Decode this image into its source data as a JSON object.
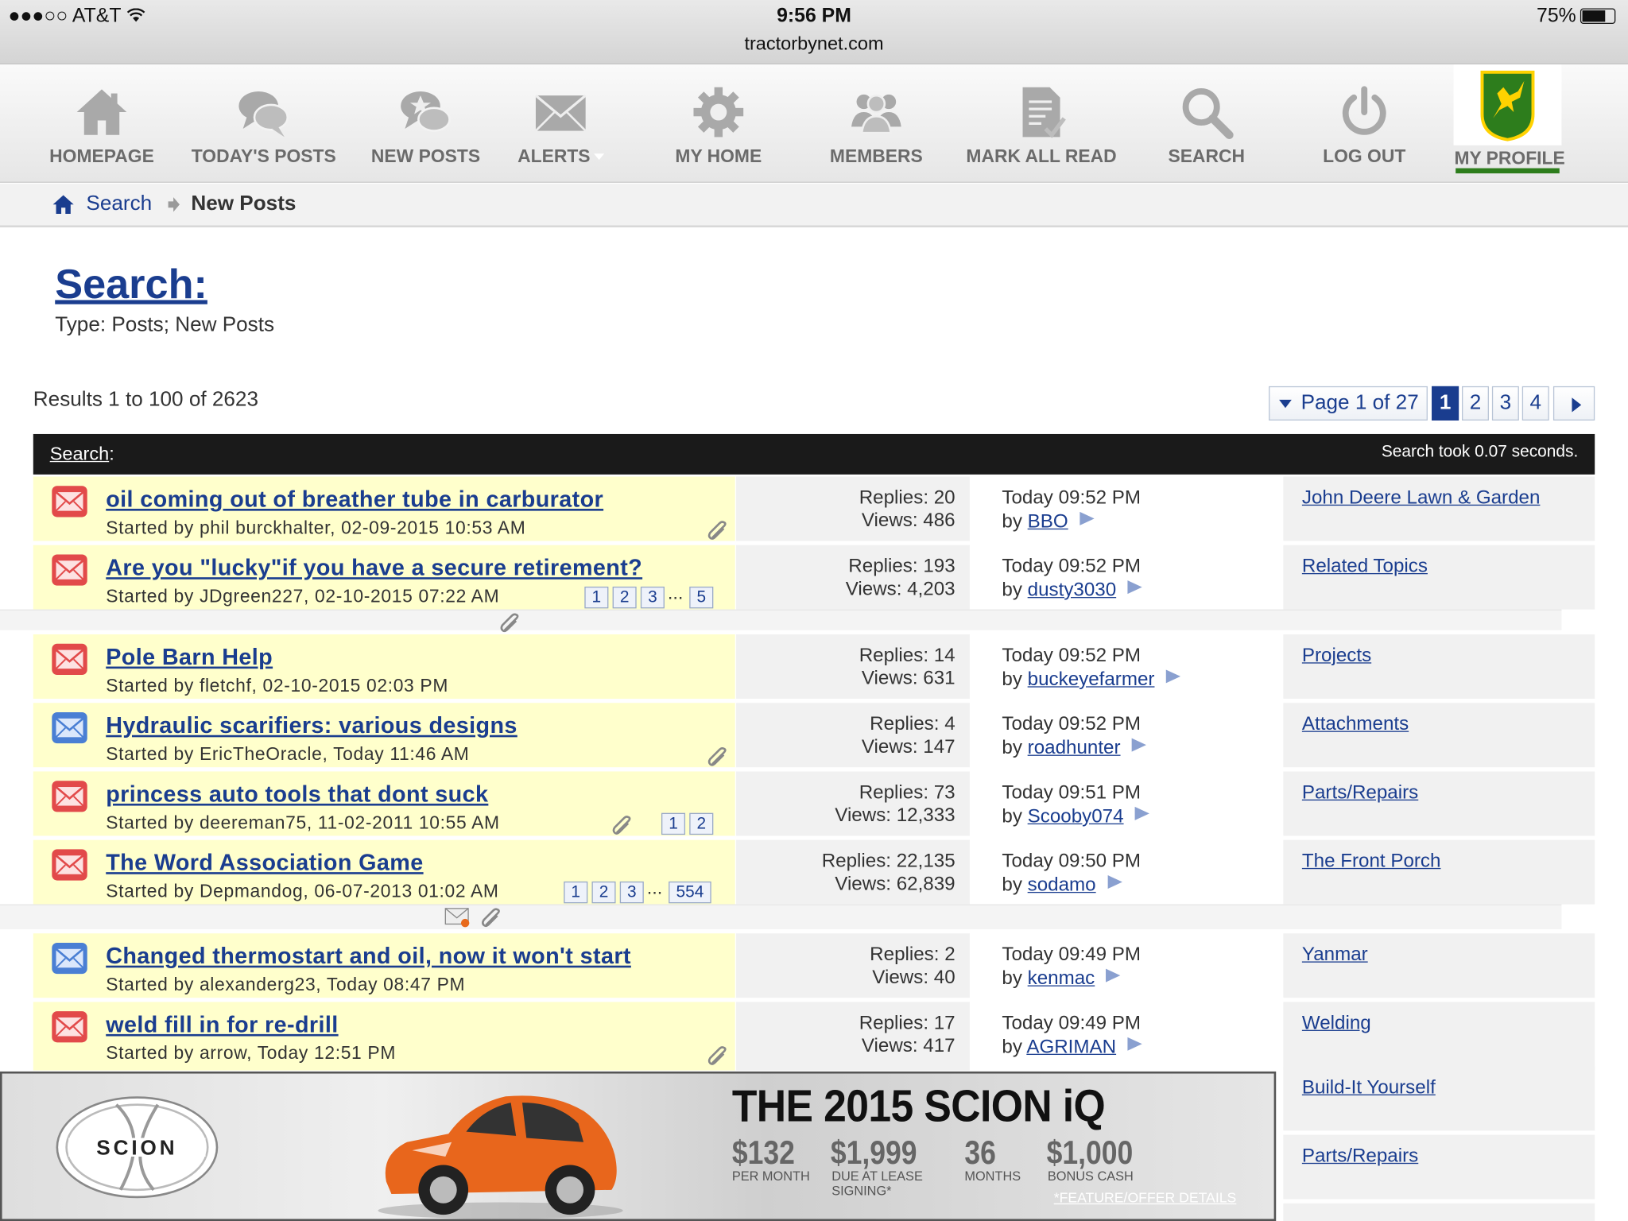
{
  "status_bar": {
    "carrier": "●●●○○ AT&T",
    "time": "9:56 PM",
    "url": "tractorbynet.com",
    "battery": "75%"
  },
  "nav": {
    "items": [
      {
        "label": "HOMEPAGE",
        "icon": "home-icon"
      },
      {
        "label": "TODAY'S POSTS",
        "icon": "chat-bubbles-icon"
      },
      {
        "label": "NEW POSTS",
        "icon": "chat-star-icon"
      },
      {
        "label": "ALERTS",
        "icon": "envelope-icon"
      },
      {
        "label": "MY HOME",
        "icon": "gear-icon"
      },
      {
        "label": "MEMBERS",
        "icon": "members-icon"
      },
      {
        "label": "MARK ALL READ",
        "icon": "document-check-icon"
      },
      {
        "label": "SEARCH",
        "icon": "magnifier-icon"
      },
      {
        "label": "LOG OUT",
        "icon": "power-icon"
      },
      {
        "label": "MY PROFILE",
        "icon": "john-deere-logo-icon"
      }
    ]
  },
  "breadcrumb": {
    "link": "Search",
    "current": "New Posts"
  },
  "page": {
    "title": "Search:",
    "subtitle": "Type: Posts; New Posts",
    "results": "Results 1 to 100 of 2623"
  },
  "pagination": {
    "label": "Page 1 of 27",
    "pages": [
      "1",
      "2",
      "3",
      "4"
    ],
    "active": "1"
  },
  "results_header": {
    "left_link": "Search",
    "left_colon": ":",
    "right": "Search took 0.07 seconds."
  },
  "threads": [
    {
      "title": "oil coming out of breather tube in carburator",
      "started": "Started by phil burckhalter, 02-09-2015 10:53 AM",
      "replies": "Replies: 20",
      "views": "Views: 486",
      "last_date": "Today 09:52 PM",
      "last_by_prefix": "by",
      "last_by": "BBO",
      "forum": "John Deere Lawn & Garden",
      "icon": "envelope-red-icon",
      "pages": []
    },
    {
      "title": "Are you \"lucky\"if you have a secure retirement?",
      "started": "Started by JDgreen227, 02-10-2015 07:22 AM",
      "replies": "Replies: 193",
      "views": "Views: 4,203",
      "last_date": "Today 09:52 PM",
      "last_by_prefix": "by",
      "last_by": "dusty3030",
      "forum": "Related Topics",
      "icon": "envelope-red-icon",
      "pages": [
        "1",
        "2",
        "3",
        "...",
        "5"
      ]
    },
    {
      "title": "Pole Barn Help",
      "started": "Started by fletchf, 02-10-2015 02:03 PM",
      "replies": "Replies: 14",
      "views": "Views: 631",
      "last_date": "Today 09:52 PM",
      "last_by_prefix": "by",
      "last_by": "buckeyefarmer",
      "forum": "Projects",
      "icon": "envelope-red-icon",
      "pages": []
    },
    {
      "title": "Hydraulic scarifiers: various designs",
      "started": "Started by EricTheOracle, Today 11:46 AM",
      "replies": "Replies: 4",
      "views": "Views: 147",
      "last_date": "Today 09:52 PM",
      "last_by_prefix": "by",
      "last_by": "roadhunter",
      "forum": "Attachments",
      "icon": "envelope-blue-icon",
      "pages": []
    },
    {
      "title": "princess auto tools that dont suck",
      "started": "Started by deereman75, 11-02-2011 10:55 AM",
      "replies": "Replies: 73",
      "views": "Views: 12,333",
      "last_date": "Today 09:51 PM",
      "last_by_prefix": "by",
      "last_by": "Scooby074",
      "forum": "Parts/Repairs",
      "icon": "envelope-red-icon",
      "pages": [
        "1",
        "2"
      ]
    },
    {
      "title": "The Word Association Game",
      "started": "Started by Depmandog, 06-07-2013 01:02 AM",
      "replies": "Replies: 22,135",
      "views": "Views: 62,839",
      "last_date": "Today 09:50 PM",
      "last_by_prefix": "by",
      "last_by": "sodamo",
      "forum": "The Front Porch",
      "icon": "envelope-red-icon",
      "pages": [
        "1",
        "2",
        "3",
        "...",
        "554"
      ]
    },
    {
      "title": "Changed thermostart and oil, now it won't start",
      "started": "Started by alexanderg23, Today 08:47 PM",
      "replies": "Replies: 2",
      "views": "Views: 40",
      "last_date": "Today 09:49 PM",
      "last_by_prefix": "by",
      "last_by": "kenmac",
      "forum": "Yanmar",
      "icon": "envelope-blue-icon",
      "pages": []
    },
    {
      "title": "weld fill in for re-drill",
      "started": "Started by arrow, Today 12:51 PM",
      "replies": "Replies: 17",
      "views": "Views: 417",
      "last_date": "Today 09:49 PM",
      "last_by_prefix": "by",
      "last_by": "AGRIMAN",
      "forum": "Welding",
      "icon": "envelope-red-icon",
      "pages": []
    }
  ],
  "extra_forums": [
    "Build-It Yourself",
    "Parts/Repairs"
  ],
  "ad": {
    "logo_text": "SCION",
    "headline": "THE 2015 SCION iQ",
    "offers": [
      {
        "value": "$132",
        "label": "PER MONTH"
      },
      {
        "value": "$1,999",
        "label": "DUE AT LEASE SIGNING*"
      },
      {
        "value": "36",
        "label": "MONTHS"
      },
      {
        "value": "$1,000",
        "label": "BONUS CASH"
      }
    ],
    "terms": "*FEATURE/OFFER DETAILS",
    "colors": {
      "car": "#e8661c"
    }
  },
  "colors": {
    "link": "#1a3d8f",
    "thread_bg": "#ffffcc",
    "header_bg": "#1a1a1a"
  }
}
